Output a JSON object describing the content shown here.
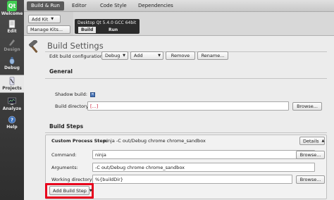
{
  "modes": [
    {
      "label": "Welcome",
      "icon": "qt-logo-icon",
      "logo_text": "Qt"
    },
    {
      "label": "Edit",
      "icon": "edit-document-icon"
    },
    {
      "label": "Design",
      "icon": "design-pen-icon"
    },
    {
      "label": "Debug",
      "icon": "bug-icon"
    },
    {
      "label": "Projects",
      "icon": "projects-wrench-icon"
    },
    {
      "label": "Analyze",
      "icon": "analyze-monitor-icon"
    },
    {
      "label": "Help",
      "icon": "help-icon"
    }
  ],
  "tabs": [
    "Build & Run",
    "Editor",
    "Code Style",
    "Dependencies"
  ],
  "left": {
    "add_kit": "Add Kit",
    "manage_kits": "Manage Kits..."
  },
  "kit": {
    "name": "Desktop Qt 5.4.0 GCC 64bit",
    "build_tab": "Build",
    "run_tab": "Run"
  },
  "page_title": "Build Settings",
  "config": {
    "label": "Edit build configuration:",
    "value": "Debug",
    "add": "Add",
    "remove": "Remove",
    "rename": "Rename..."
  },
  "general": {
    "heading": "General",
    "shadow_label": "Shadow build:",
    "dir_label": "Build directory:",
    "dir_value": "[...]",
    "browse": "Browse..."
  },
  "steps": {
    "heading": "Build Steps",
    "custom_title": "Custom Process Step:",
    "custom_summary": "ninja -C out/Debug chrome chrome_sandbox",
    "details": "Details",
    "command_label": "Command:",
    "command_value": "ninja",
    "args_label": "Arguments:",
    "args_value": "-C out/Debug chrome chrome_sandbox",
    "workdir_label": "Working directory:",
    "workdir_value": "%{buildDir}",
    "browse": "Browse...",
    "add_step": "Add Build Step"
  },
  "colors": {
    "accent_highlight": "#e8001c",
    "qt_green": "#41cd52"
  }
}
